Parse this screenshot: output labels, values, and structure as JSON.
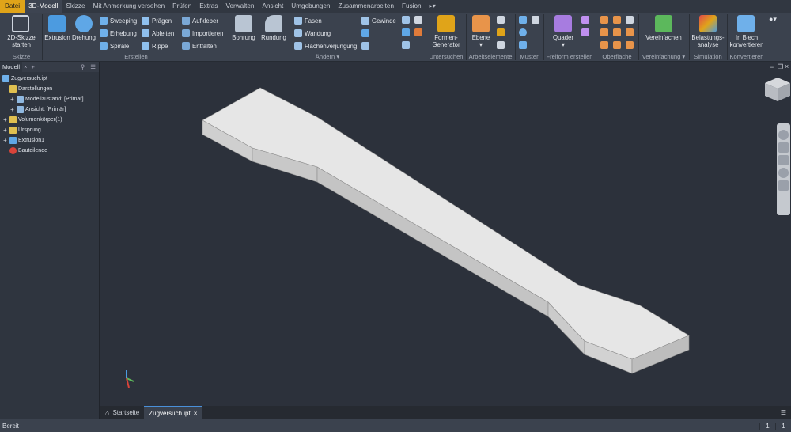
{
  "menu": {
    "items": [
      "Datei",
      "3D-Modell",
      "Skizze",
      "Mit Anmerkung versehen",
      "Prüfen",
      "Extras",
      "Verwalten",
      "Ansicht",
      "Umgebungen",
      "Zusammenarbeiten",
      "Fusion"
    ],
    "active_index": 1
  },
  "ribbon": {
    "skizze": {
      "label": "2D-Skizze\nstarten",
      "group": "Skizze"
    },
    "erstellen": {
      "group": "Erstellen",
      "extrusion": "Extrusion",
      "drehung": "Drehung",
      "sweeping": "Sweeping",
      "erhebung": "Erhebung",
      "spirale": "Spirale",
      "praegen": "Prägen",
      "ableiten": "Ableiten",
      "rippe": "Rippe",
      "aufkleber": "Aufkleber",
      "importieren": "Importieren",
      "entfalten": "Entfalten"
    },
    "aendern": {
      "group": "Ändern",
      "bohrung": "Bohrung",
      "rundung": "Rundung",
      "fasen": "Fasen",
      "wandung": "Wandung",
      "flaechenverjuengung": "Flächenverjüngung",
      "gewinde": "Gewinde"
    },
    "untersuchen": {
      "group": "Untersuchen",
      "formen": "Formen-\nGenerator"
    },
    "arbeitselemente": {
      "group": "Arbeitselemente",
      "ebene": "Ebene"
    },
    "muster": {
      "group": "Muster"
    },
    "freiform": {
      "group": "Freiform erstellen",
      "quader": "Quader"
    },
    "oberflaeche": {
      "group": "Oberfläche"
    },
    "vereinfachung": {
      "group": "Vereinfachung",
      "vereinfachen": "Vereinfachen"
    },
    "simulation": {
      "group": "Simulation",
      "belastung": "Belastungs-\nanalyse"
    },
    "konvertieren": {
      "group": "Konvertieren",
      "blech": "In Blech\nkonvertieren"
    }
  },
  "browser": {
    "tab": "Modell",
    "tree": [
      {
        "label": "Zugversuch.ipt",
        "level": 0,
        "expander": ""
      },
      {
        "label": "Darstellungen",
        "level": 0,
        "expander": "−"
      },
      {
        "label": "Modellzustand: [Primär]",
        "level": 1,
        "expander": "+"
      },
      {
        "label": "Ansicht: [Primär]",
        "level": 1,
        "expander": "+"
      },
      {
        "label": "Volumenkörper(1)",
        "level": 0,
        "expander": "+"
      },
      {
        "label": "Ursprung",
        "level": 0,
        "expander": "+"
      },
      {
        "label": "Extrusion1",
        "level": 0,
        "expander": "+"
      },
      {
        "label": "Bauteilende",
        "level": 0,
        "expander": ""
      }
    ]
  },
  "tabs": {
    "home": "Startseite",
    "document": "Zugversuch.ipt"
  },
  "status": {
    "text": "Bereit",
    "count1": "1",
    "count2": "1"
  },
  "colors": {
    "accent_file": "#e0a419",
    "viewport": "#2c313b",
    "part_top": "#e6e6e6",
    "part_side": "#c9c9c9"
  }
}
